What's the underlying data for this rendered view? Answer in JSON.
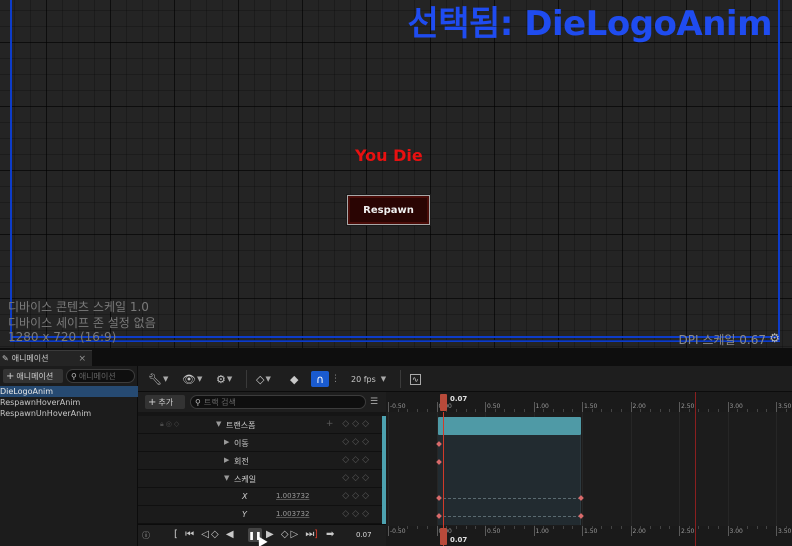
{
  "viewport": {
    "selected_label": "선택됨: DieLogoAnim",
    "you_die": "You Die",
    "respawn_button": "Respawn",
    "device_content_scale": "디바이스 콘텐츠 스케일 1.0",
    "device_safe_zone": "디바이스 세이프 존 설정 없음",
    "resolution": "1280 x 720 (16:9)",
    "dpi_scale": "DPI 스케일 0.67",
    "accent_color": "#0d3cc9"
  },
  "panel": {
    "tab_label": "애니메이션",
    "add_animation": "애니메이션",
    "animation_search_placeholder": "애니메이션",
    "animations": [
      "DieLogoAnim",
      "RespawnHoverAnim",
      "RespawnUnHoverAnim"
    ],
    "selected_animation": "DieLogoAnim"
  },
  "toolbar": {
    "fps": "20 fps"
  },
  "tracks": {
    "add_track": "추가",
    "search_placeholder": "트랙 검색",
    "rows": [
      {
        "label": "트랜스폼"
      },
      {
        "label": "이동"
      },
      {
        "label": "회전"
      },
      {
        "label": "스케일"
      },
      {
        "label": "X",
        "value": "1.003732"
      },
      {
        "label": "Y",
        "value": "1.003732"
      }
    ]
  },
  "timeline": {
    "current_time": "0.07",
    "ticks": [
      "-0.50",
      "0.00",
      "0.50",
      "1.00",
      "1.50",
      "2.00",
      "2.50",
      "3.00",
      "3.50"
    ],
    "section_color": "#4f9aa6"
  },
  "transport": {
    "time_display": "0.07"
  }
}
